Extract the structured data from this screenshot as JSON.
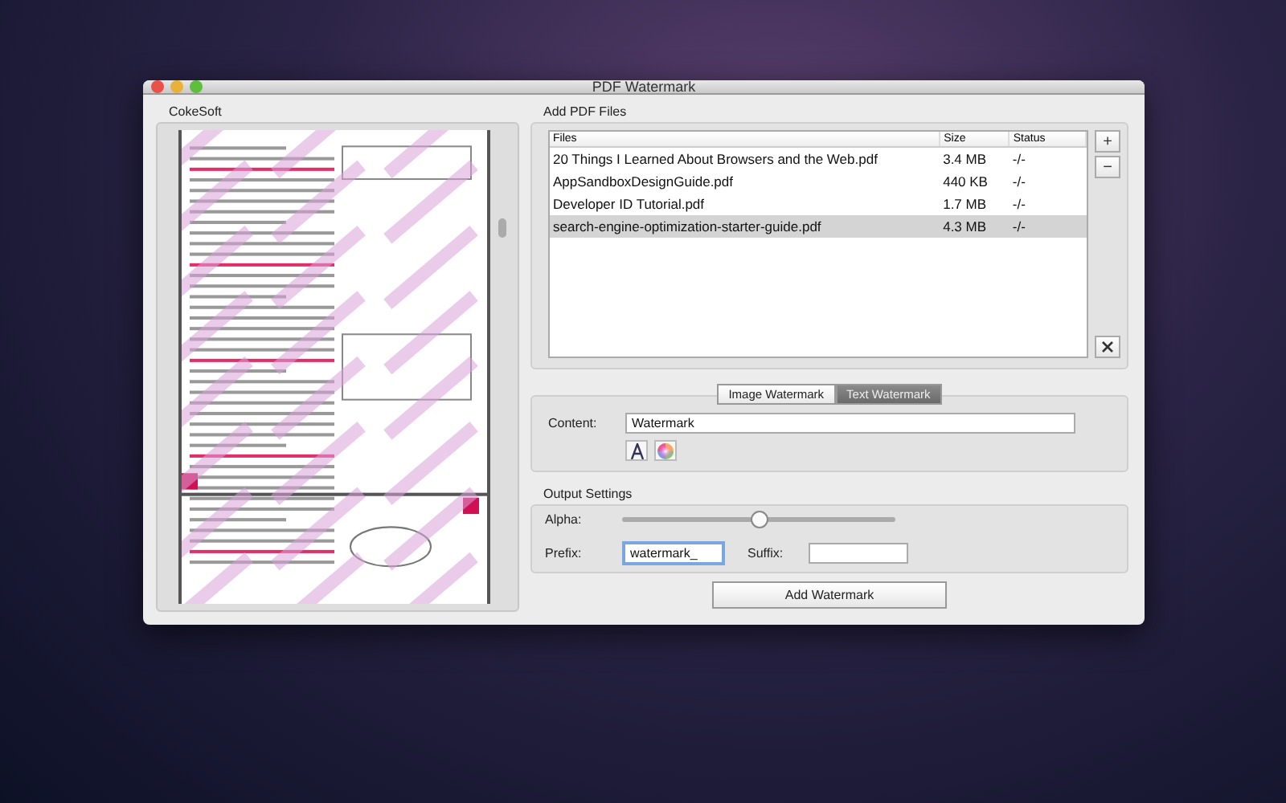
{
  "window": {
    "title": "PDF Watermark"
  },
  "preview": {
    "label": "CokeSoft"
  },
  "files": {
    "label": "Add PDF Files",
    "columns": [
      "Files",
      "Size",
      "Status"
    ],
    "rows": [
      {
        "name": "20 Things I Learned About Browsers and the Web.pdf",
        "size": "3.4 MB",
        "status": "-/-",
        "selected": false
      },
      {
        "name": "AppSandboxDesignGuide.pdf",
        "size": "440 KB",
        "status": "-/-",
        "selected": false
      },
      {
        "name": "Developer ID Tutorial.pdf",
        "size": "1.7 MB",
        "status": "-/-",
        "selected": false
      },
      {
        "name": "search-engine-optimization-starter-guide.pdf",
        "size": "4.3 MB",
        "status": "-/-",
        "selected": true
      }
    ],
    "add_button": "+",
    "remove_button": "−"
  },
  "watermark": {
    "tabs": [
      {
        "label": "Image Watermark",
        "selected": false
      },
      {
        "label": "Text Watermark",
        "selected": true
      }
    ],
    "content_label": "Content:",
    "content_value": "Watermark"
  },
  "output": {
    "label": "Output Settings",
    "alpha_label": "Alpha:",
    "alpha": {
      "level": 0.5
    },
    "prefix_label": "Prefix:",
    "prefix_value": "watermark_",
    "suffix_label": "Suffix:"
  },
  "action_button": "Add Watermark"
}
